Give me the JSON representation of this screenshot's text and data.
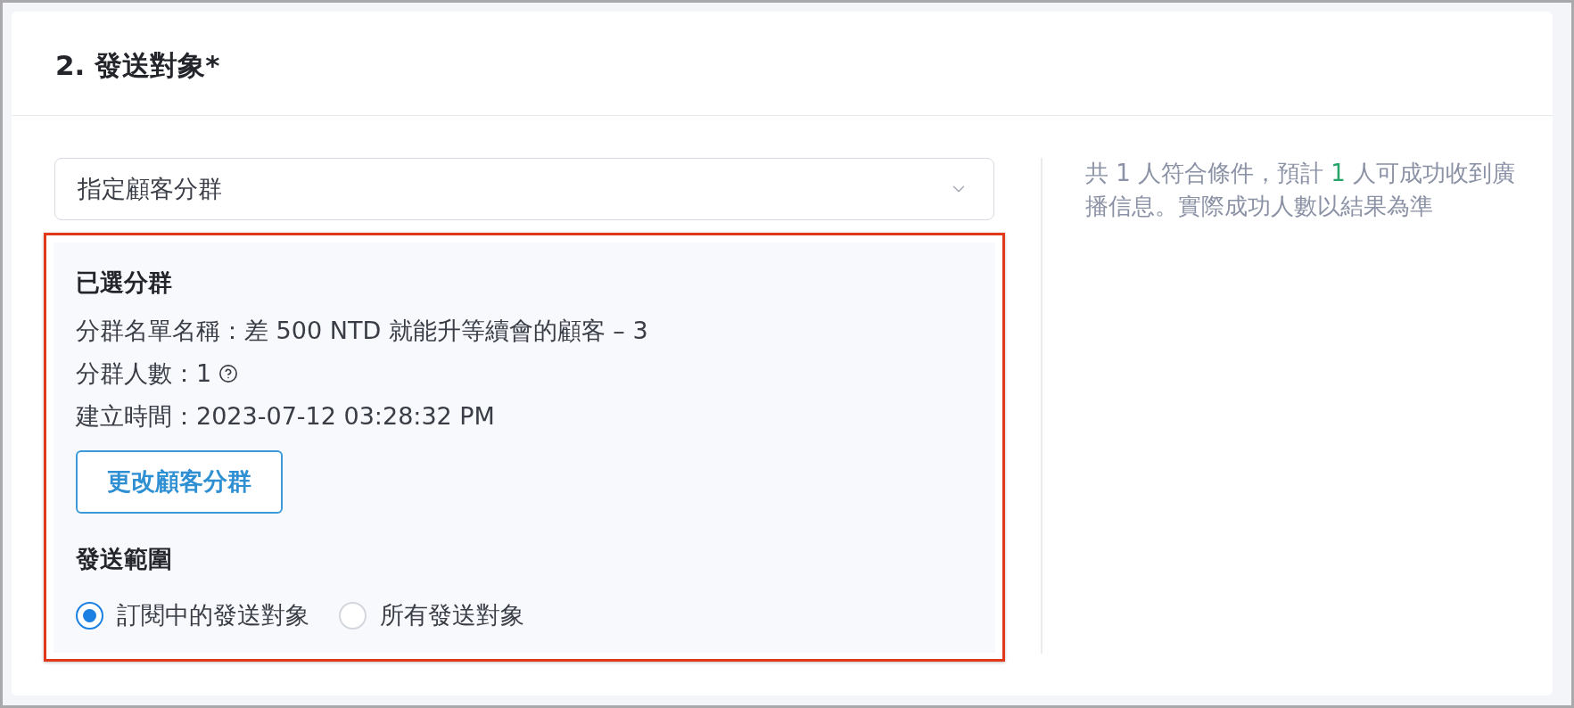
{
  "section": {
    "title": "2. 發送對象*"
  },
  "audience_select": {
    "value": "指定顧客分群"
  },
  "selected_segment": {
    "highlighted": true,
    "heading": "已選分群",
    "details": [
      {
        "text": "分群名單名稱：差 500 NTD 就能升等續會的顧客 – 3",
        "help": false
      },
      {
        "text": "分群人數：1",
        "help": true
      },
      {
        "text": "建立時間：2023-07-12 03:28:32 PM",
        "help": false
      }
    ],
    "change_button": "更改顧客分群"
  },
  "send_scope": {
    "heading": "發送範圍",
    "options": [
      {
        "label": "訂閱中的發送對象",
        "selected": true
      },
      {
        "label": "所有發送對象",
        "selected": false
      }
    ]
  },
  "summary": {
    "before": "共 1 人符合條件，預計",
    "count": "1",
    "after": "人可成功收到廣播信息。實際成功人數以結果為準"
  }
}
